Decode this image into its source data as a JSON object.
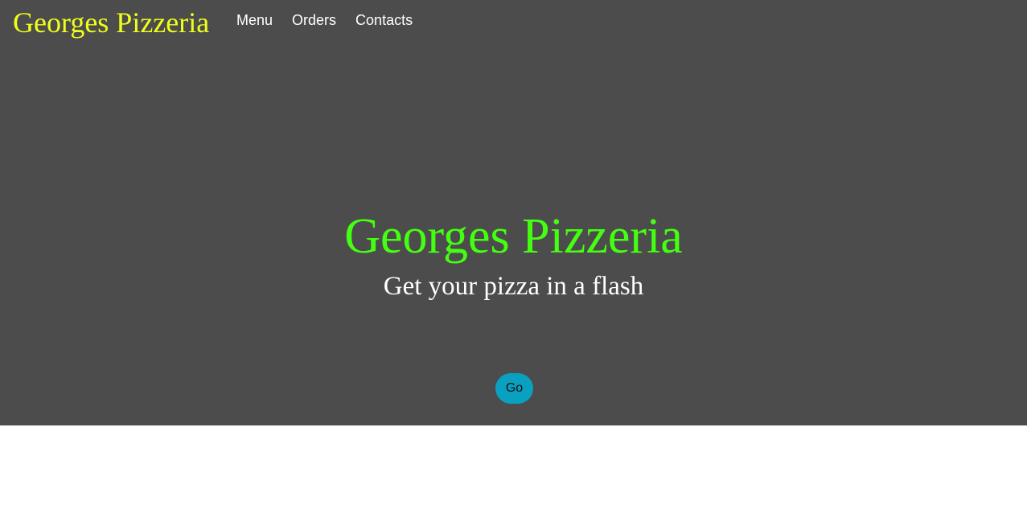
{
  "colors": {
    "hero_background": "#4c4c4c",
    "brand_text": "#f0ff1a",
    "hero_title_text": "#44ff11",
    "button_background": "#0aa0c0"
  },
  "header": {
    "brand": "Georges Pizzeria",
    "nav": [
      {
        "label": "Menu"
      },
      {
        "label": "Orders"
      },
      {
        "label": "Contacts"
      }
    ]
  },
  "hero": {
    "title": "Georges Pizzeria",
    "subtitle": "Get your pizza in a flash",
    "button_label": "Go"
  }
}
